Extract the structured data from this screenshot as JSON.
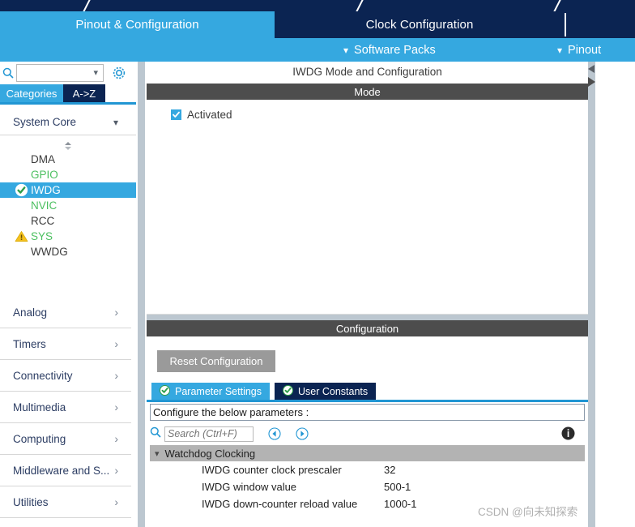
{
  "window": {
    "main_tabs": [
      {
        "label": "Pinout & Configuration",
        "active": true
      },
      {
        "label": "Clock Configuration",
        "active": false
      }
    ],
    "sub_items": [
      {
        "label": "Software Packs",
        "icon": "chevron-down-icon"
      },
      {
        "label": "Pinout",
        "icon": "chevron-down-icon"
      }
    ]
  },
  "sidebar": {
    "search": {
      "value": "",
      "placeholder": ""
    },
    "search_icon": "search-icon",
    "settings_icon": "gear-icon",
    "view_tabs": [
      {
        "label": "Categories",
        "active": true
      },
      {
        "label": "A->Z",
        "active": false
      }
    ],
    "group": {
      "label": "System Core",
      "chevron": "chevron-down-icon"
    },
    "scroll_spinner": "scroll-up-down-icon",
    "peripherals": [
      {
        "label": "DMA",
        "state": "plain",
        "badge": "none"
      },
      {
        "label": "GPIO",
        "state": "green",
        "badge": "none"
      },
      {
        "label": "IWDG",
        "state": "selected",
        "badge": "check-icon"
      },
      {
        "label": "NVIC",
        "state": "green",
        "badge": "none"
      },
      {
        "label": "RCC",
        "state": "plain",
        "badge": "none"
      },
      {
        "label": "SYS",
        "state": "green",
        "badge": "warning-icon"
      },
      {
        "label": "WWDG",
        "state": "plain",
        "badge": "none"
      }
    ],
    "categories": [
      {
        "label": "Analog",
        "arrow": "chevron-right-icon"
      },
      {
        "label": "Timers",
        "arrow": "chevron-right-icon"
      },
      {
        "label": "Connectivity",
        "arrow": "chevron-right-icon"
      },
      {
        "label": "Multimedia",
        "arrow": "chevron-right-icon"
      },
      {
        "label": "Computing",
        "arrow": "chevron-right-icon"
      },
      {
        "label": "Middleware and S...",
        "arrow": "chevron-right-icon"
      },
      {
        "label": "Utilities",
        "arrow": "chevron-right-icon"
      }
    ]
  },
  "main": {
    "title": "IWDG Mode and Configuration",
    "mode_header": "Mode",
    "mode_checkbox": {
      "label": "Activated",
      "checked": true,
      "icon": "check-icon"
    },
    "configuration_header": "Configuration",
    "reset_button": "Reset Configuration",
    "param_tabs": [
      {
        "label": "Parameter Settings",
        "active": true,
        "icon": "check-circle-icon"
      },
      {
        "label": "User Constants",
        "active": false,
        "icon": "check-circle-icon"
      }
    ],
    "configure_hint": "Configure the below parameters :",
    "search": {
      "value": "",
      "placeholder": "Search (Ctrl+F)"
    },
    "search_icon": "search-icon",
    "prev_icon": "prev-circle-icon",
    "next_icon": "next-circle-icon",
    "info_icon": "info-icon",
    "table": {
      "group_label": "Watchdog Clocking",
      "group_chevron": "chevron-down-icon",
      "rows": [
        {
          "name": "IWDG counter clock prescaler",
          "value": "32"
        },
        {
          "name": "IWDG window value",
          "value": "500-1"
        },
        {
          "name": "IWDG down-counter reload value",
          "value": "1000-1"
        }
      ]
    }
  },
  "right_edge": {
    "collapse_up_icon": "triangle-left-icon",
    "collapse_down_icon": "triangle-right-icon"
  },
  "watermark": "CSDN @向未知探索",
  "colors": {
    "accent_blue": "#35a8e0",
    "navy": "#0b2452",
    "dark_bar": "#4d4d4d",
    "green": "#4bbf5f",
    "group_gray": "#b3b3b3",
    "splitter": "#bcc7d0"
  }
}
